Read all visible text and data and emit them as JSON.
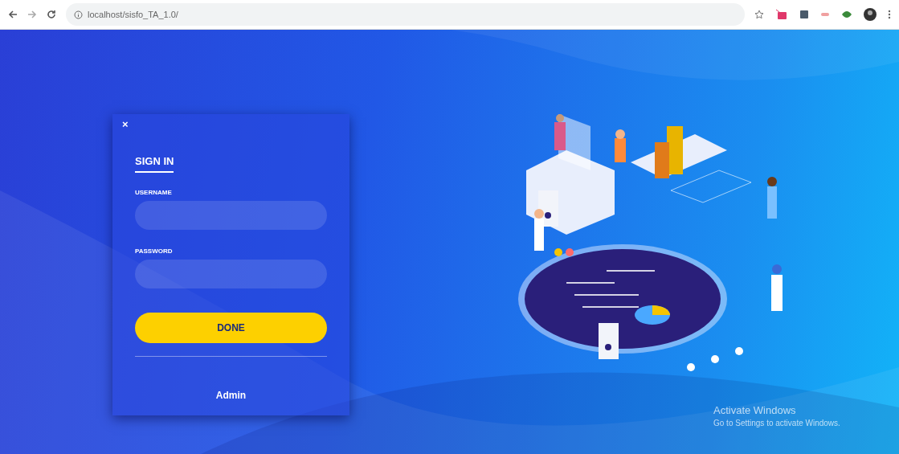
{
  "browser": {
    "url": "localhost/sisfo_TA_1.0/"
  },
  "login": {
    "close": "×",
    "title": "SIGN IN",
    "fields": [
      {
        "label": "USERNAME"
      },
      {
        "label": "PASSWORD"
      }
    ],
    "button": "DONE",
    "link": "Admin"
  },
  "os_notice": {
    "title": "Activate Windows",
    "message": "Go to Settings to activate Windows."
  }
}
